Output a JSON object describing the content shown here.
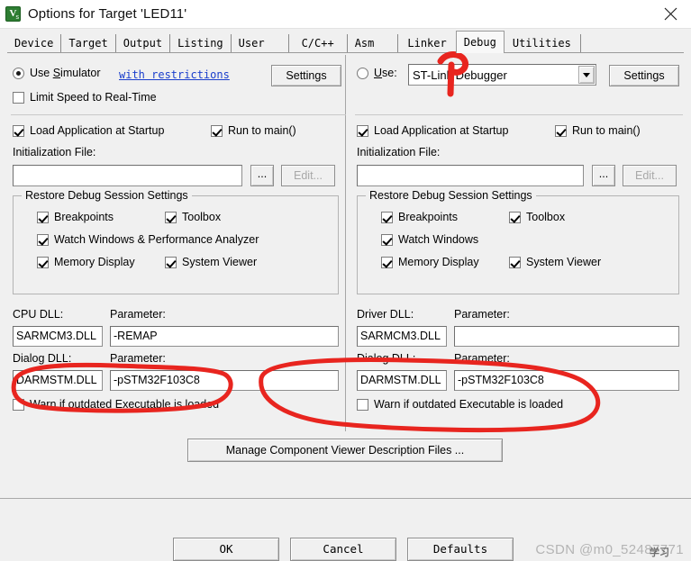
{
  "window": {
    "title": "Options for Target 'LED11'",
    "icon": "uvision-icon",
    "close_label": "close-icon"
  },
  "tabs": [
    {
      "label": "Device",
      "selected": false
    },
    {
      "label": "Target",
      "selected": false
    },
    {
      "label": "Output",
      "selected": false
    },
    {
      "label": "Listing",
      "selected": false
    },
    {
      "label": "User",
      "selected": false
    },
    {
      "label": "C/C++",
      "selected": false
    },
    {
      "label": "Asm",
      "selected": false
    },
    {
      "label": "Linker",
      "selected": false
    },
    {
      "label": "Debug",
      "selected": true
    },
    {
      "label": "Utilities",
      "selected": false
    }
  ],
  "left": {
    "use_simulator_label": "Use Simulator",
    "use_simulator_checked": true,
    "restrictions_link": "with restrictions",
    "settings_button": "Settings",
    "limit_speed_label": "Limit Speed to Real-Time",
    "limit_speed_checked": false,
    "load_app_label": "Load Application at Startup",
    "load_app_checked": true,
    "run_to_main_label": "Run to main()",
    "run_to_main_checked": true,
    "init_file_label": "Initialization File:",
    "init_file_value": "",
    "browse_button": "...",
    "edit_button": "Edit...",
    "edit_disabled": true,
    "restore_group": "Restore Debug Session Settings",
    "restore_items": [
      {
        "label": "Breakpoints",
        "checked": true
      },
      {
        "label": "Toolbox",
        "checked": true
      },
      {
        "label": "Watch Windows & Performance Analyzer",
        "checked": true
      },
      {
        "label": "Memory Display",
        "checked": true
      },
      {
        "label": "System Viewer",
        "checked": true
      }
    ],
    "cpu_dll_label": "CPU DLL:",
    "cpu_dll_value": "SARMCM3.DLL",
    "cpu_param_label": "Parameter:",
    "cpu_param_value": "-REMAP",
    "dialog_dll_label": "Dialog DLL:",
    "dialog_dll_value": "DARMSTM.DLL",
    "dialog_param_label": "Parameter:",
    "dialog_param_value": "-pSTM32F103C8",
    "warn_label": "Warn if outdated Executable is loaded",
    "warn_checked": false
  },
  "right": {
    "use_label": "Use:",
    "use_checked": false,
    "debugger_value": "ST-Link Debugger",
    "settings_button": "Settings",
    "load_app_label": "Load Application at Startup",
    "load_app_checked": true,
    "run_to_main_label": "Run to main()",
    "run_to_main_checked": true,
    "init_file_label": "Initialization File:",
    "init_file_value": "",
    "browse_button": "...",
    "edit_button": "Edit...",
    "edit_disabled": true,
    "restore_group": "Restore Debug Session Settings",
    "restore_items": [
      {
        "label": "Breakpoints",
        "checked": true
      },
      {
        "label": "Toolbox",
        "checked": true
      },
      {
        "label": "Watch Windows",
        "checked": true
      },
      {
        "label": "Memory Display",
        "checked": true
      },
      {
        "label": "System Viewer",
        "checked": true
      }
    ],
    "driver_dll_label": "Driver DLL:",
    "driver_dll_value": "SARMCM3.DLL",
    "driver_param_label": "Parameter:",
    "driver_param_value": "",
    "dialog_dll_label": "Dialog DLL:",
    "dialog_dll_value": "DARMSTM.DLL",
    "dialog_param_label": "Parameter:",
    "dialog_param_value": "-pSTM32F103C8",
    "warn_label": "Warn if outdated Executable is loaded",
    "warn_checked": false
  },
  "manage_button": "Manage Component Viewer Description Files ...",
  "footer": {
    "ok": "OK",
    "cancel": "Cancel",
    "defaults": "Defaults"
  },
  "watermark": {
    "text": "CSDN @m0_52487771",
    "overlay": "学习"
  },
  "colors": {
    "dialog_bg": "#f0f0f0",
    "annotation_red": "#e8251f",
    "link_blue": "#1a3ecc",
    "icon_green": "#2e7d32"
  }
}
